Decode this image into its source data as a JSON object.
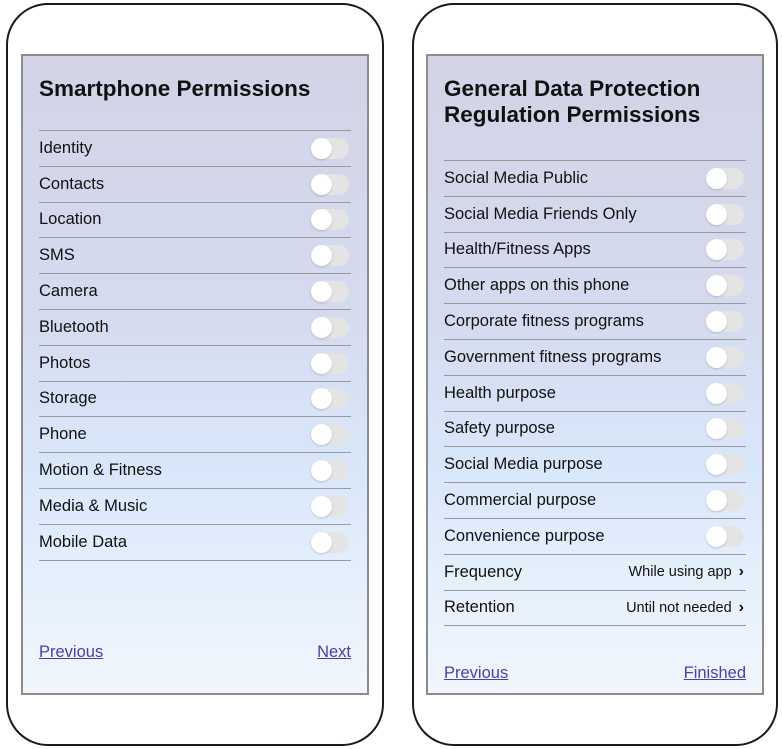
{
  "left_panel": {
    "title": "Smartphone Permissions",
    "items": [
      {
        "label": "Identity",
        "enabled": false
      },
      {
        "label": "Contacts",
        "enabled": false
      },
      {
        "label": "Location",
        "enabled": false
      },
      {
        "label": "SMS",
        "enabled": false
      },
      {
        "label": "Camera",
        "enabled": false
      },
      {
        "label": "Bluetooth",
        "enabled": false
      },
      {
        "label": "Photos",
        "enabled": false
      },
      {
        "label": "Storage",
        "enabled": false
      },
      {
        "label": "Phone",
        "enabled": false
      },
      {
        "label": "Motion & Fitness",
        "enabled": false
      },
      {
        "label": "Media & Music",
        "enabled": false
      },
      {
        "label": "Mobile Data",
        "enabled": false
      }
    ],
    "previous_label": "Previous",
    "next_label": "Next"
  },
  "right_panel": {
    "title": "General Data Protection Regulation Permissions",
    "items": [
      {
        "label": "Social Media Public",
        "enabled": false
      },
      {
        "label": "Social Media Friends Only",
        "enabled": false
      },
      {
        "label": "Health/Fitness Apps",
        "enabled": false
      },
      {
        "label": "Other apps on this phone",
        "enabled": false
      },
      {
        "label": "Corporate fitness programs",
        "enabled": false
      },
      {
        "label": "Government fitness programs",
        "enabled": false
      },
      {
        "label": "Health purpose",
        "enabled": false
      },
      {
        "label": "Safety purpose",
        "enabled": false
      },
      {
        "label": "Social Media purpose",
        "enabled": false
      },
      {
        "label": "Commercial purpose",
        "enabled": false
      },
      {
        "label": "Convenience purpose",
        "enabled": false
      }
    ],
    "settings": [
      {
        "label": "Frequency",
        "value": "While using app"
      },
      {
        "label": "Retention",
        "value": "Until not needed"
      }
    ],
    "previous_label": "Previous",
    "finished_label": "Finished"
  },
  "colors": {
    "link": "#4b3fa0",
    "toggle_off": "#e4e4e4",
    "divider": "#9a9a9a"
  },
  "icons": {
    "chevron": "chevron-right-icon"
  }
}
